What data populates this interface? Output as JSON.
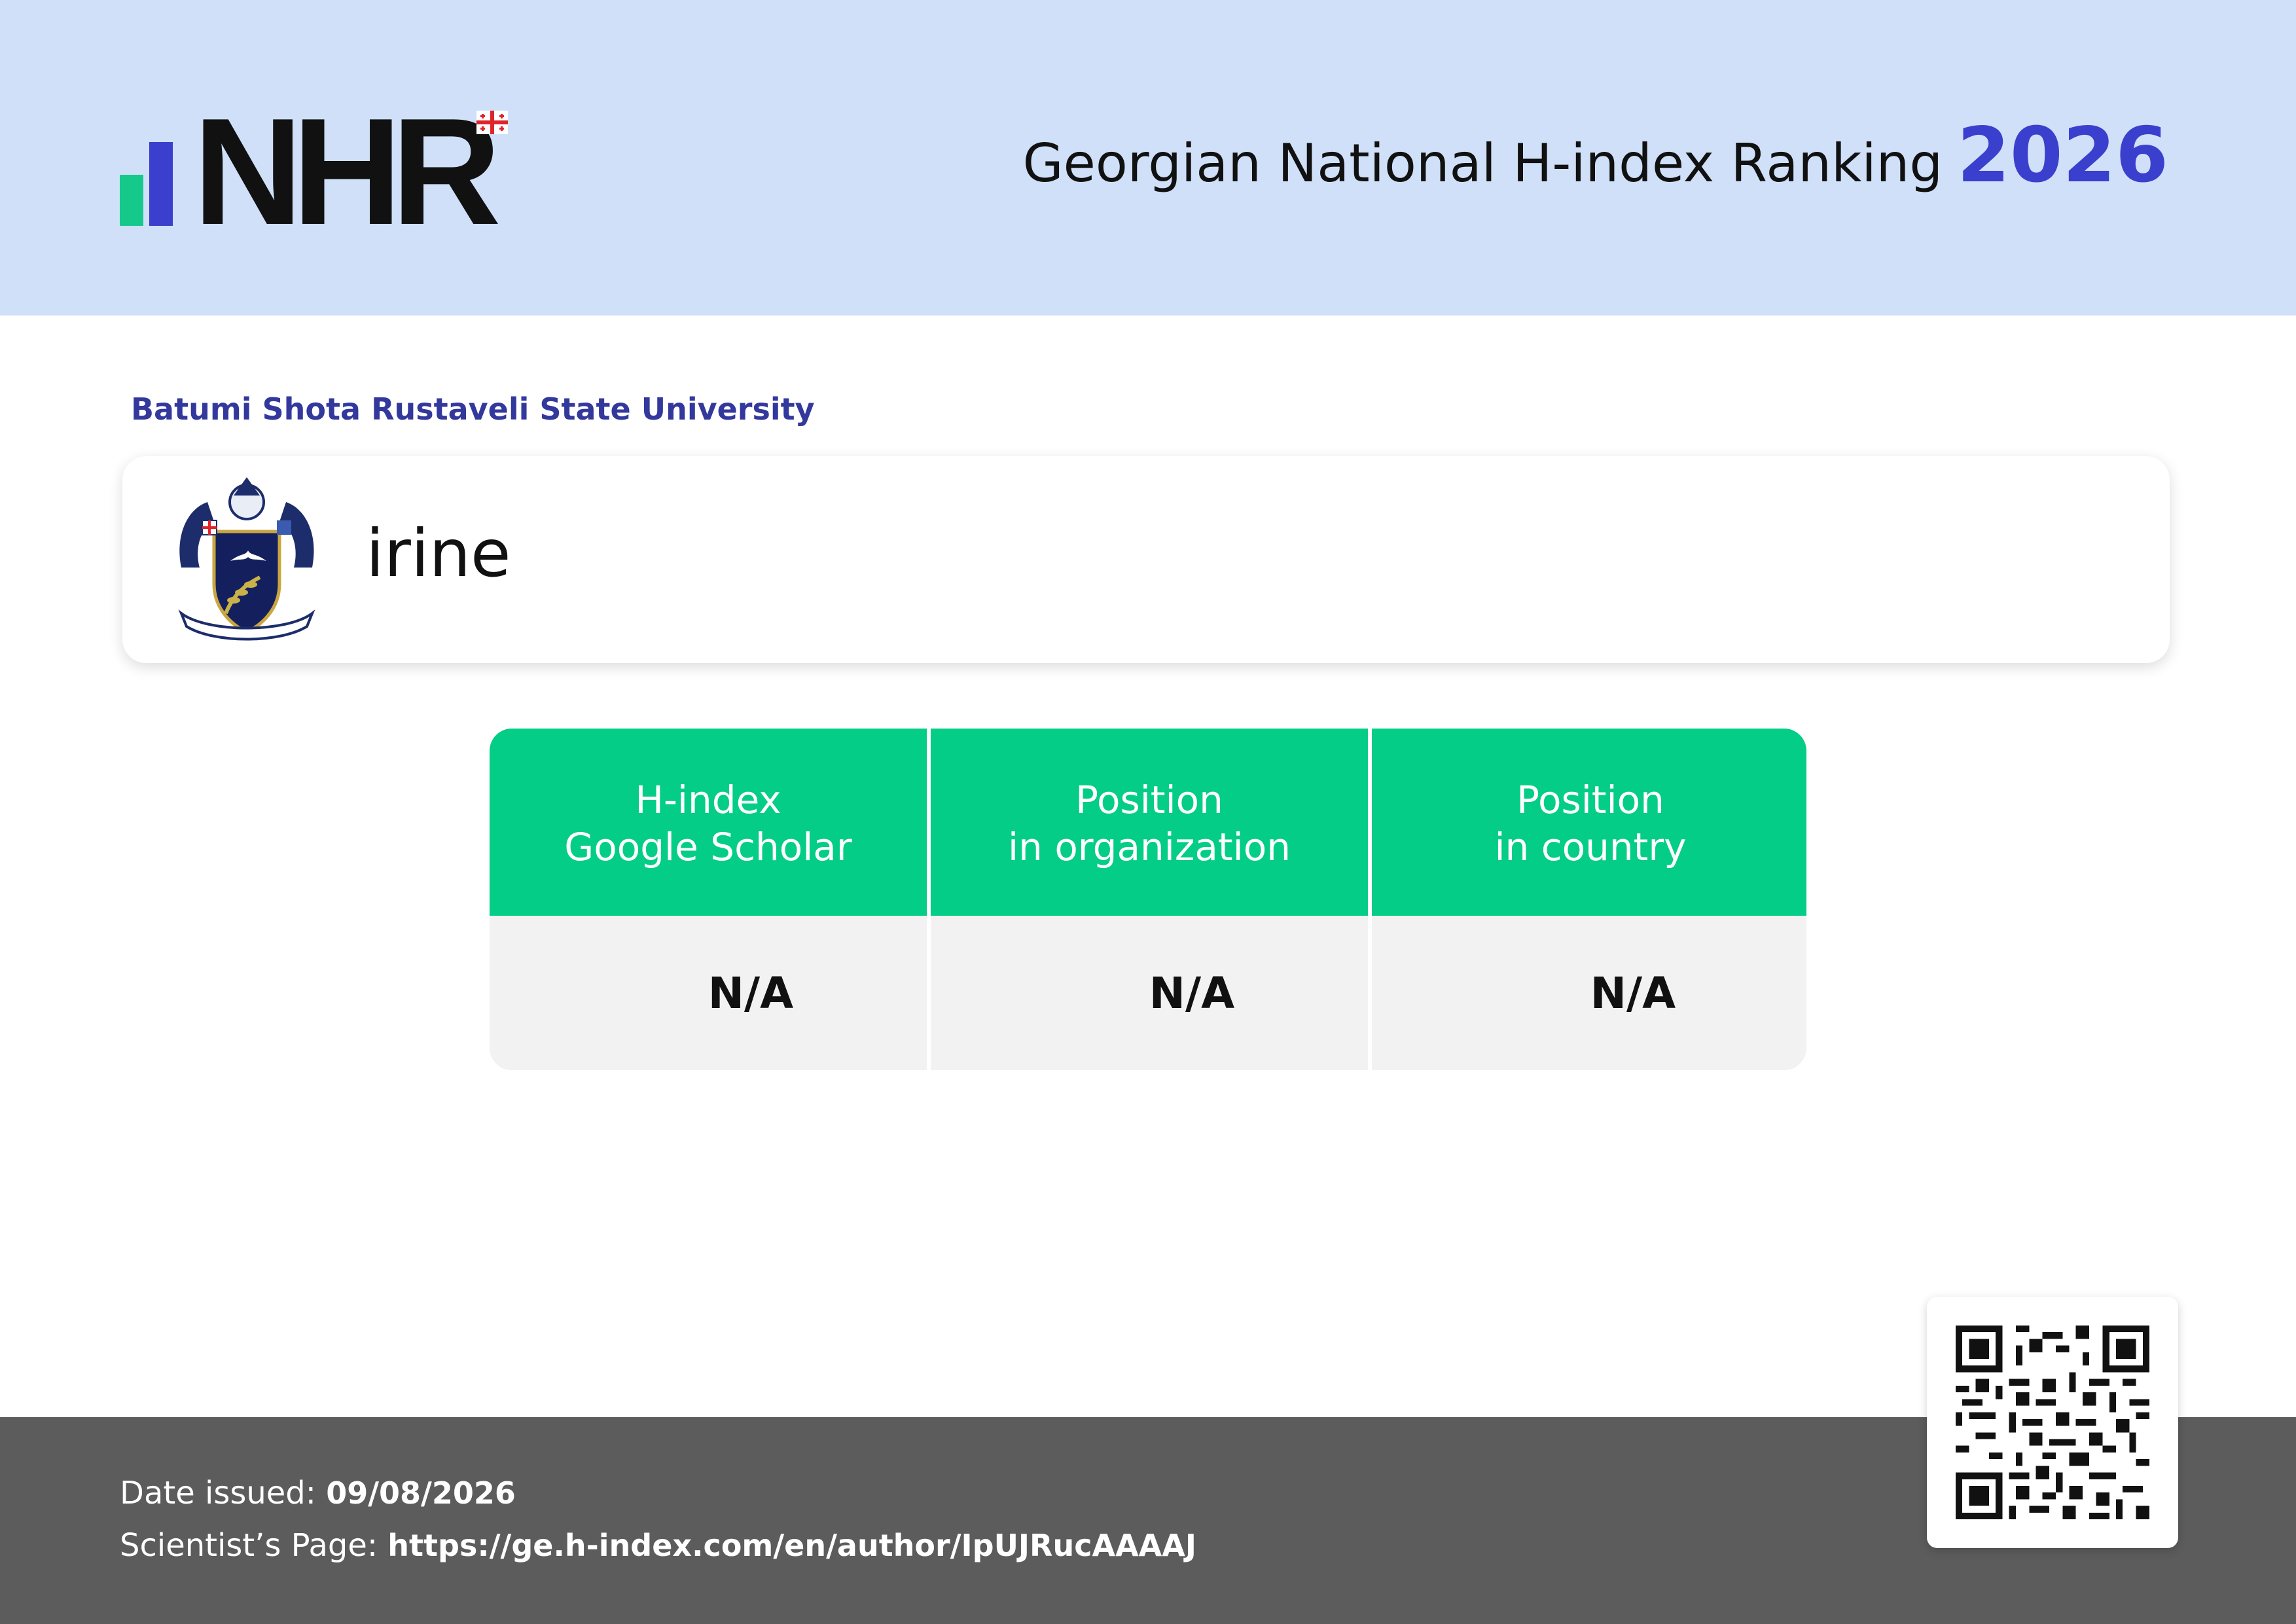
{
  "header": {
    "logo_text": "NHR",
    "title": "Georgian National H-index Ranking",
    "year": "2026"
  },
  "colors": {
    "header_bg": "#cfe0f8",
    "accent_blue": "#3a3fce",
    "accent_green": "#03cd86",
    "footer_bg": "#5c5c5c"
  },
  "organization": "Batumi Shota Rustaveli State University",
  "scientist": {
    "name": "irine",
    "crest_icon": "university-crest-icon"
  },
  "stats": {
    "headers": [
      {
        "line1": "H-index",
        "line2": "Google Scholar"
      },
      {
        "line1": "Position",
        "line2": "in organization"
      },
      {
        "line1": "Position",
        "line2": "in country"
      }
    ],
    "values": [
      "N/A",
      "N/A",
      "N/A"
    ]
  },
  "footer": {
    "date_label": "Date issued:",
    "date_value": "09/08/2026",
    "page_label": "Scientist’s Page:",
    "page_url": "https://ge.h-index.com/en/author/IpUJRucAAAAJ"
  },
  "qr_icon": "qr-code-icon"
}
